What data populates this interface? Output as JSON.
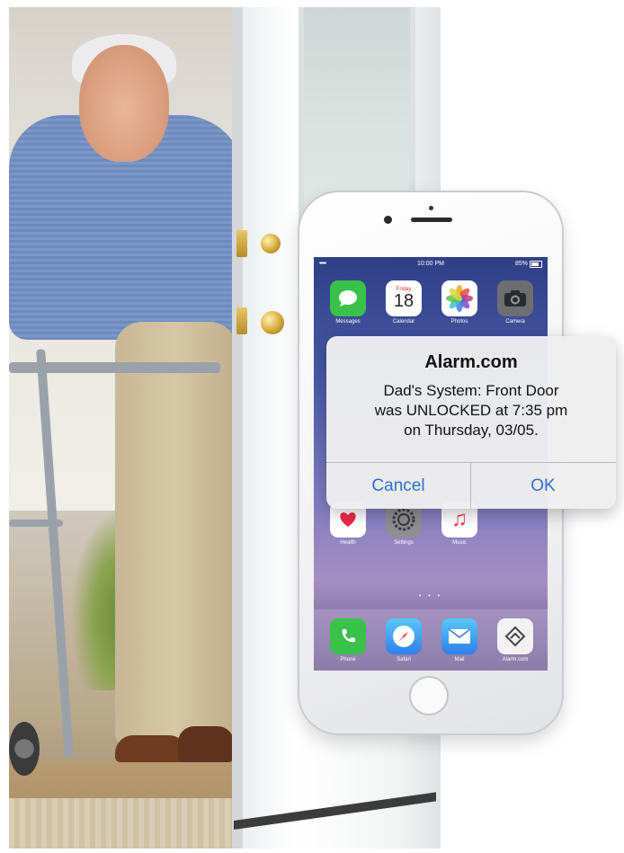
{
  "statusbar": {
    "signal": "•••••",
    "time": "10:00 PM",
    "battery": "85%"
  },
  "home_screen": {
    "top_row": [
      {
        "label": "Messages",
        "icon": "messages-icon",
        "color": "#3ac14a"
      },
      {
        "label": "Calendar",
        "icon": "calendar-icon",
        "color": "#ffffff",
        "day_name": "Friday",
        "day_number": "18"
      },
      {
        "label": "Photos",
        "icon": "photos-icon",
        "color": "#ffffff"
      },
      {
        "label": "Camera",
        "icon": "camera-icon",
        "color": "#6d6e72"
      }
    ],
    "bottom_row": [
      {
        "label": "Health",
        "icon": "health-icon",
        "color": "#ffffff"
      },
      {
        "label": "Settings",
        "icon": "settings-icon",
        "color": "#8e8e93"
      },
      {
        "label": "Music",
        "icon": "music-icon",
        "color": "#ffffff"
      }
    ],
    "page_dots": "• • •",
    "dock": [
      {
        "label": "Phone",
        "icon": "phone-icon",
        "color": "#3ac14a"
      },
      {
        "label": "Safari",
        "icon": "safari-icon",
        "color": "#2f7fe8"
      },
      {
        "label": "Mail",
        "icon": "mail-icon",
        "color": "#2f7fe8"
      },
      {
        "label": "Alarm.com",
        "icon": "alarm-com-icon",
        "color": "#f2f2f2"
      }
    ]
  },
  "alert": {
    "title": "Alarm.com",
    "message_lines": [
      "Dad's System: Front Door",
      "was UNLOCKED at 7:35 pm",
      "on Thursday, 03/05."
    ],
    "cancel_label": "Cancel",
    "ok_label": "OK",
    "button_color": "#2f6fcc"
  }
}
